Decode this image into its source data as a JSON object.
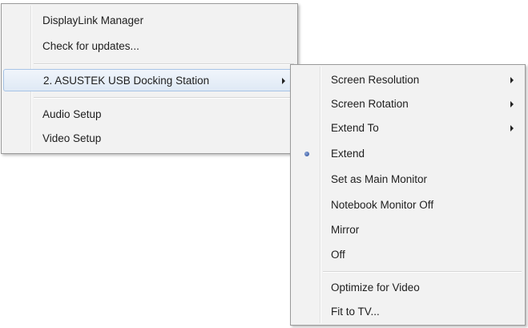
{
  "main_menu": {
    "items": [
      {
        "label": "DisplayLink Manager"
      },
      {
        "label": "Check for updates..."
      },
      {
        "label": "2. ASUSTEK USB Docking Station"
      },
      {
        "label": "Audio Setup"
      },
      {
        "label": "Video Setup"
      }
    ]
  },
  "submenu": {
    "items": [
      {
        "label": "Screen Resolution"
      },
      {
        "label": "Screen Rotation"
      },
      {
        "label": "Extend To"
      },
      {
        "label": "Extend"
      },
      {
        "label": "Set as Main Monitor"
      },
      {
        "label": "Notebook Monitor Off"
      },
      {
        "label": "Mirror"
      },
      {
        "label": "Off"
      },
      {
        "label": "Optimize for Video"
      },
      {
        "label": "Fit to TV..."
      }
    ]
  }
}
